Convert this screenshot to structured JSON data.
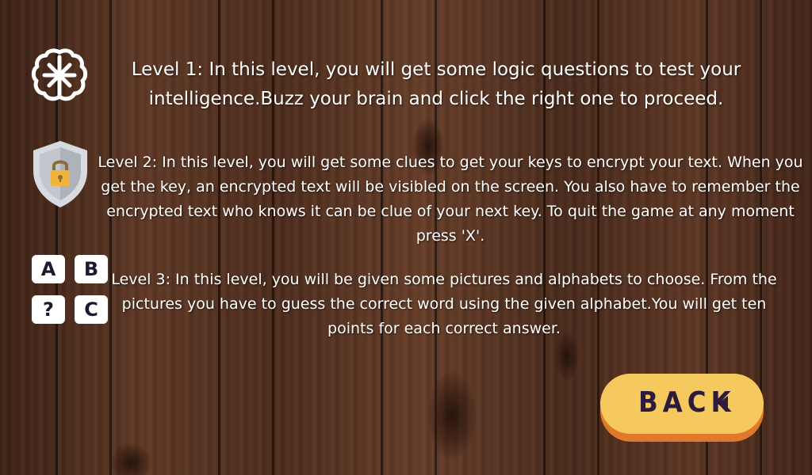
{
  "instructions": {
    "level1": "Level 1:  In this level, you will get some logic questions to test your intelligence.Buzz your brain and click the right one to proceed.",
    "level2": "Level 2: In this level, you will get some clues to get your keys to encrypt your text. When you get the key, an encrypted text will be visibled on the screen. You also have to remember the encrypted text who knows it can be clue of your next key. To quit the game at any moment press 'X'.",
    "level3": "Level 3: In this level, you will be given some pictures and alphabets to  choose. From the pictures you have to guess the correct word using the given alphabet.You will get ten points for each correct answer."
  },
  "icons": {
    "level1": "brain-icon",
    "level2": "shield-lock-icon",
    "level3": "letter-tiles-icon"
  },
  "tiles": [
    "A",
    "B",
    "?",
    "C"
  ],
  "back_button": {
    "label": "BACK"
  },
  "colors": {
    "button_face": "#f6c95e",
    "button_shadow": "#e07a2a",
    "button_text": "#2d1b3d",
    "shield": "#bfc3c9",
    "lock": "#f2b33d",
    "text": "#ffffff"
  }
}
